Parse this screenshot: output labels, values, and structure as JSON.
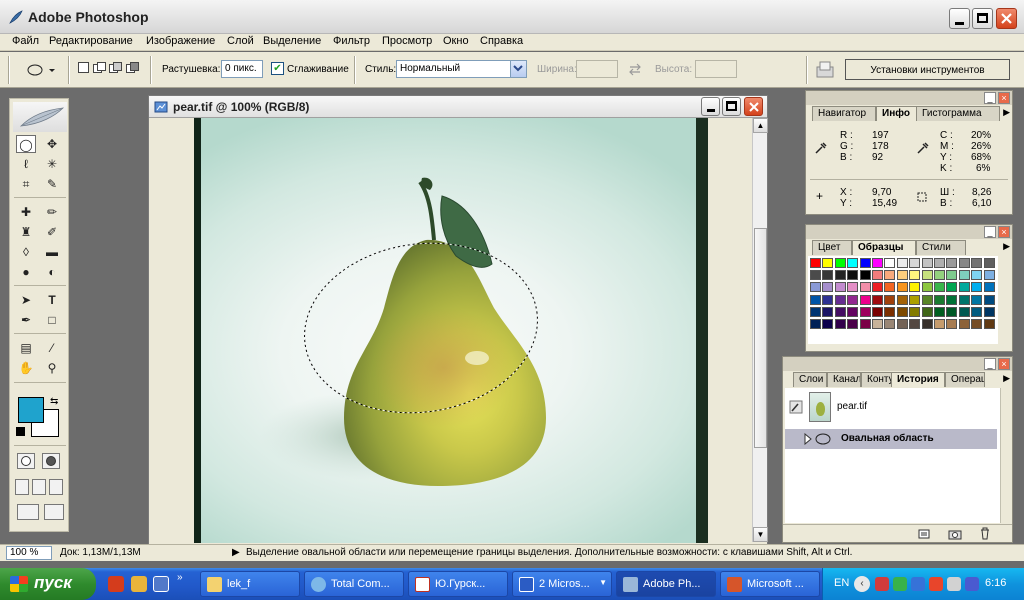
{
  "app": {
    "title": "Adobe Photoshop"
  },
  "menu": [
    "Файл",
    "Редактирование",
    "Изображение",
    "Слой",
    "Выделение",
    "Фильтр",
    "Просмотр",
    "Окно",
    "Справка"
  ],
  "options": {
    "feather_label": "Растушевка:",
    "feather_value": "0 пикс.",
    "antialias_label": "Сглаживание",
    "style_label": "Стиль:",
    "style_value": "Нормальный",
    "width_label": "Ширина:",
    "height_label": "Высота:",
    "tool_presets": "Установки инструментов"
  },
  "document": {
    "title": "pear.tif @ 100% (RGB/8)"
  },
  "status": {
    "zoom": "100 %",
    "doc_info": "Док: 1,13M/1,13M",
    "hint": "Выделение овальной области или перемещение границы выделения. Дополнительные возможности: с клавишами Shift, Alt и Ctrl."
  },
  "info_palette": {
    "tabs": [
      "Навигатор",
      "Инфо",
      "Гистограмма"
    ],
    "rgb": {
      "R": "197",
      "G": "178",
      "B": "92"
    },
    "cmyk": {
      "C": "20%",
      "M": "26%",
      "Y": "68%",
      "K": "6%"
    },
    "xy": {
      "X": "9,70",
      "Y": "15,49"
    },
    "wh": {
      "W": "8,26",
      "H": "6,10"
    },
    "labels": {
      "R": "R :",
      "G": "G :",
      "B": "B :",
      "C": "C :",
      "M": "M :",
      "Y": "Y :",
      "K": "K :",
      "X": "X :",
      "Yc": "Y :",
      "W": "Ш :",
      "H": "В :"
    }
  },
  "swatches_palette": {
    "tabs": [
      "Цвет",
      "Образцы",
      "Стили"
    ],
    "colors": [
      "#ff0000",
      "#ffff00",
      "#00ff00",
      "#00ffff",
      "#0000ff",
      "#ff00ff",
      "#ffffff",
      "#ebebeb",
      "#d7d7d7",
      "#c3c3c3",
      "#afafaf",
      "#9b9b9b",
      "#878787",
      "#737373",
      "#5f5f5f",
      "#4b4b4b",
      "#373737",
      "#232323",
      "#0f0f0f",
      "#000000",
      "#f27c7c",
      "#f7a97c",
      "#fdcd7d",
      "#fff57e",
      "#c6e17e",
      "#93d17e",
      "#7ecb8e",
      "#7ecfbc",
      "#7ed4f2",
      "#7eb0e2",
      "#8a9ad6",
      "#a68fcc",
      "#c38ccf",
      "#e48ec6",
      "#f28ea9",
      "#ed2024",
      "#f26522",
      "#f7941d",
      "#fff200",
      "#8dc63f",
      "#39b54a",
      "#00a651",
      "#00a99d",
      "#00aeef",
      "#0072bc",
      "#0054a6",
      "#2e3192",
      "#662d91",
      "#92278f",
      "#ec008c",
      "#9e0b0f",
      "#a0410d",
      "#a36209",
      "#aba000",
      "#598527",
      "#197b30",
      "#007236",
      "#00746b",
      "#0076a3",
      "#004b80",
      "#003471",
      "#1b1464",
      "#440e62",
      "#630460",
      "#9e005d",
      "#790000",
      "#7b2e00",
      "#7d4900",
      "#827b00",
      "#406618",
      "#005e20",
      "#005826",
      "#005952",
      "#005b7f",
      "#003663",
      "#002157",
      "#0d004c",
      "#32004b",
      "#4b0049",
      "#7b0046",
      "#c7b299",
      "#998675",
      "#736357",
      "#534741",
      "#37302a",
      "#c69c6d",
      "#a67c52",
      "#8c6239",
      "#754c24",
      "#603913"
    ]
  },
  "history_palette": {
    "tabs": [
      "Слои",
      "Каналы",
      "Контуры",
      "История",
      "Операции"
    ],
    "snapshot": "pear.tif",
    "step": "Овальная область"
  },
  "taskbar": {
    "start": "пуск",
    "tasks": [
      "lek_f",
      "Total Com...",
      "Ю.Гурск...",
      "2 Micros...",
      "Adobe Ph...",
      "Microsoft ..."
    ],
    "lang": "EN",
    "clock": "6:16"
  }
}
